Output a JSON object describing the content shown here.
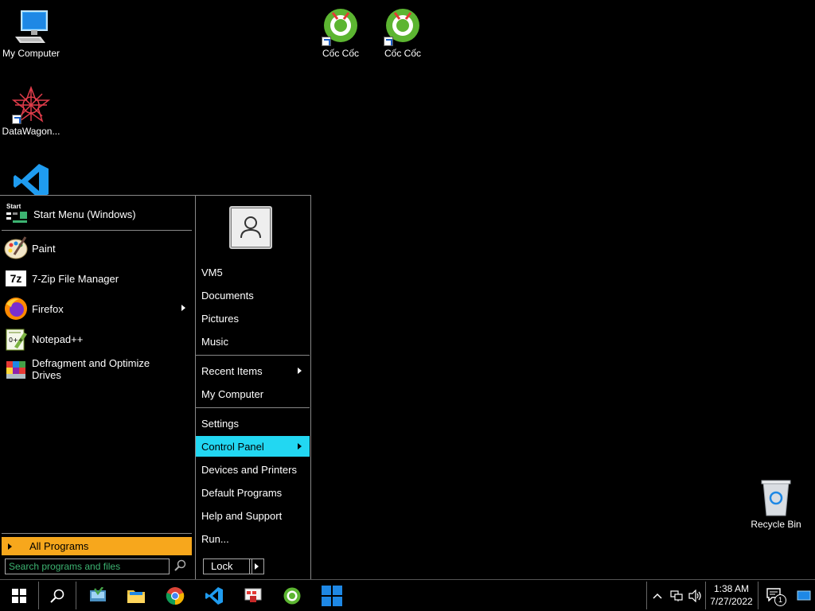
{
  "desktop": {
    "icons": [
      {
        "label": "My Computer"
      },
      {
        "label": "DataWagon..."
      },
      {
        "label": "Cốc Cốc"
      },
      {
        "label": "Cốc Cốc"
      },
      {
        "label": "Recycle Bin"
      }
    ]
  },
  "start_menu": {
    "header": {
      "icon_text": "Start",
      "label": "Start Menu (Windows)"
    },
    "programs": [
      {
        "label": "Paint",
        "has_submenu": false
      },
      {
        "label": "7-Zip File Manager",
        "icon_text": "7z",
        "has_submenu": false
      },
      {
        "label": "Firefox",
        "has_submenu": true
      },
      {
        "label": "Notepad++",
        "has_submenu": false
      },
      {
        "label": "Defragment and Optimize Drives",
        "has_submenu": false
      }
    ],
    "all_programs": "All Programs",
    "search": {
      "placeholder": "Search programs and files"
    },
    "right": {
      "user": "VM5",
      "items": [
        {
          "label": "Documents"
        },
        {
          "label": "Pictures"
        },
        {
          "label": "Music"
        },
        {
          "label": "Recent Items"
        },
        {
          "label": "My Computer"
        },
        {
          "label": "Settings"
        },
        {
          "label": "Control Panel"
        },
        {
          "label": "Devices and Printers"
        },
        {
          "label": "Default Programs"
        },
        {
          "label": "Help and Support"
        },
        {
          "label": "Run..."
        }
      ],
      "highlighted": "Control Panel",
      "lock": "Lock"
    }
  },
  "taskbar": {
    "time": "1:38 AM",
    "date": "7/27/2022",
    "notification_count": "1"
  },
  "colors": {
    "accent_orange": "#f7a71c",
    "highlight_cyan": "#22d7f2",
    "search_text": "#3cb371"
  }
}
